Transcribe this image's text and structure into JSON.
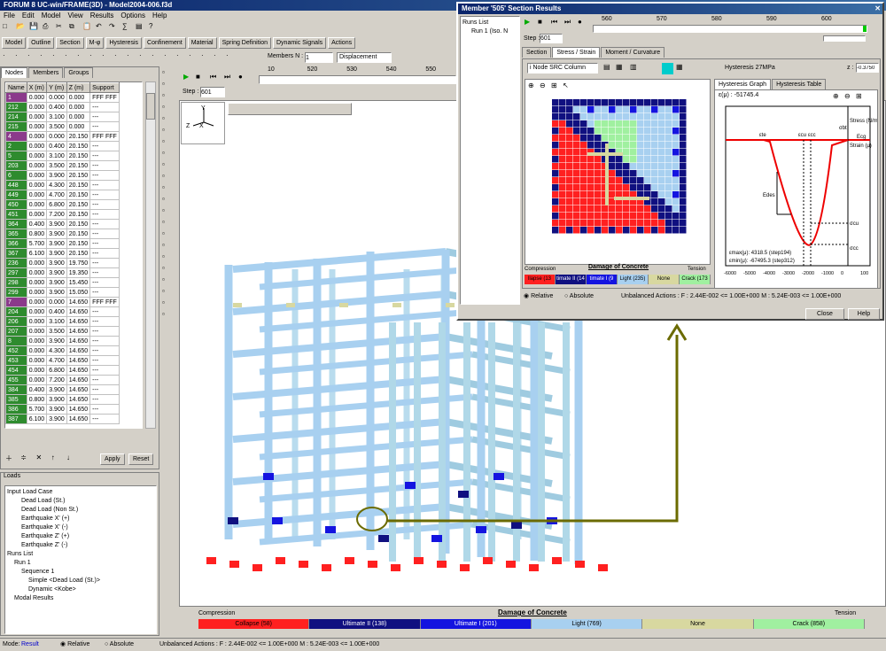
{
  "app": {
    "title": "FORUM 8 UC-win/FRAME(3D) - Model2004-006.f3d"
  },
  "menu": [
    "File",
    "Edit",
    "Model",
    "View",
    "Results",
    "Options",
    "Help"
  ],
  "toolbar2": [
    "Model",
    "Outline",
    "Section",
    "M-φ",
    "Hysteresis",
    "Confinement",
    "Material",
    "Spring Definition",
    "Dynamic Signals",
    "Actions"
  ],
  "viewer": {
    "members_label": "Members N :",
    "members_value": "1",
    "display_select": "Displacement",
    "ticks": [
      "10",
      "520",
      "530",
      "540",
      "550"
    ],
    "step_label": "Step :",
    "step_value": "601"
  },
  "left_tabs": [
    "Nodes",
    "Members",
    "Groups"
  ],
  "nodes_table": {
    "headers": [
      "Name",
      "X (m)",
      "Y (m)",
      "Z (m)",
      "Support"
    ],
    "rows": [
      [
        "1",
        "0.000",
        "0.000",
        "0.000",
        "FFF FFF"
      ],
      [
        "212",
        "0.000",
        "0.400",
        "0.000",
        "---"
      ],
      [
        "214",
        "0.000",
        "3.100",
        "0.000",
        "---"
      ],
      [
        "215",
        "0.000",
        "3.500",
        "0.000",
        "---"
      ],
      [
        "4",
        "0.000",
        "0.000",
        "20.150",
        "FFF FFF"
      ],
      [
        "2",
        "0.000",
        "0.400",
        "20.150",
        "---"
      ],
      [
        "5",
        "0.000",
        "3.100",
        "20.150",
        "---"
      ],
      [
        "203",
        "0.000",
        "3.500",
        "20.150",
        "---"
      ],
      [
        "6",
        "0.000",
        "3.900",
        "20.150",
        "---"
      ],
      [
        "448",
        "0.000",
        "4.300",
        "20.150",
        "---"
      ],
      [
        "449",
        "0.000",
        "4.700",
        "20.150",
        "---"
      ],
      [
        "450",
        "0.000",
        "6.800",
        "20.150",
        "---"
      ],
      [
        "451",
        "0.000",
        "7.200",
        "20.150",
        "---"
      ],
      [
        "364",
        "0.400",
        "3.900",
        "20.150",
        "---"
      ],
      [
        "365",
        "0.800",
        "3.900",
        "20.150",
        "---"
      ],
      [
        "366",
        "5.700",
        "3.900",
        "20.150",
        "---"
      ],
      [
        "367",
        "6.100",
        "3.900",
        "20.150",
        "---"
      ],
      [
        "236",
        "0.000",
        "3.900",
        "19.750",
        "---"
      ],
      [
        "297",
        "0.000",
        "3.900",
        "19.350",
        "---"
      ],
      [
        "298",
        "0.000",
        "3.900",
        "15.450",
        "---"
      ],
      [
        "299",
        "0.000",
        "3.900",
        "15.050",
        "---"
      ],
      [
        "7",
        "0.000",
        "0.000",
        "14.650",
        "FFF FFF"
      ],
      [
        "204",
        "0.000",
        "0.400",
        "14.650",
        "---"
      ],
      [
        "206",
        "0.000",
        "3.100",
        "14.650",
        "---"
      ],
      [
        "207",
        "0.000",
        "3.500",
        "14.650",
        "---"
      ],
      [
        "8",
        "0.000",
        "3.900",
        "14.650",
        "---"
      ],
      [
        "452",
        "0.000",
        "4.300",
        "14.650",
        "---"
      ],
      [
        "453",
        "0.000",
        "4.700",
        "14.650",
        "---"
      ],
      [
        "454",
        "0.000",
        "6.800",
        "14.650",
        "---"
      ],
      [
        "455",
        "0.000",
        "7.200",
        "14.650",
        "---"
      ],
      [
        "384",
        "0.400",
        "3.900",
        "14.650",
        "---"
      ],
      [
        "385",
        "0.800",
        "3.900",
        "14.650",
        "---"
      ],
      [
        "386",
        "5.700",
        "3.900",
        "14.650",
        "---"
      ],
      [
        "387",
        "6.100",
        "3.900",
        "14.650",
        "---"
      ]
    ]
  },
  "table_buttons": {
    "apply": "Apply",
    "reset": "Reset"
  },
  "loads": {
    "title": "Loads",
    "tree": [
      {
        "indent": 0,
        "text": "Input Load Case"
      },
      {
        "indent": 2,
        "text": "Dead Load (St.)"
      },
      {
        "indent": 2,
        "text": "Dead Load (Non St.)"
      },
      {
        "indent": 2,
        "text": "Earthquake X' (+)"
      },
      {
        "indent": 2,
        "text": "Earthquake X' (-)"
      },
      {
        "indent": 2,
        "text": "Earthquake Z' (+)"
      },
      {
        "indent": 2,
        "text": "Earthquake Z' (-)"
      },
      {
        "indent": 0,
        "text": "Runs List"
      },
      {
        "indent": 1,
        "text": "Run 1"
      },
      {
        "indent": 2,
        "text": "Sequence 1"
      },
      {
        "indent": 3,
        "text": "Simple <Dead Load (St.)>"
      },
      {
        "indent": 3,
        "text": "Dynamic <Kobe>"
      },
      {
        "indent": 1,
        "text": "Modal Results"
      }
    ]
  },
  "legend_main": {
    "title": "Damage of Concrete",
    "left": "Compression",
    "right": "Tension",
    "items": [
      {
        "label": "Collapse (58)",
        "color": "#ff2020"
      },
      {
        "label": "Ultimate II (138)",
        "color": "#101080"
      },
      {
        "label": "Ultimate I (201)",
        "color": "#1414e0"
      },
      {
        "label": "Light (769)",
        "color": "#a8d0f0"
      },
      {
        "label": "None",
        "color": "#d8d8a0"
      },
      {
        "label": "Crack (858)",
        "color": "#a0f0a0"
      }
    ]
  },
  "status": {
    "mode_label": "Mode:",
    "mode_value": "Result",
    "relative": "Relative",
    "absolute": "Absolute",
    "unbalanced": "Unbalanced Actions : F : 2.44E-002 <= 1.00E+000 M : 5.24E-003 <= 1.00E+000"
  },
  "dialog": {
    "title": "Member '505' Section Results",
    "runs_title": "Runs List",
    "run_item": "Run 1 (Iso. N",
    "step_label": "Step :",
    "step_value": "601",
    "ticks": [
      "560",
      "570",
      "580",
      "590",
      "600"
    ],
    "tabs": [
      "Section",
      "Stress / Strain",
      "Moment / Curvature"
    ],
    "section_select": "i Node SRC Column",
    "hysteresis_label": "Hysteresis 27MPa",
    "z_label": "z :",
    "z_value": "-0.3750",
    "graph_tabs": [
      "Hysteresis Graph",
      "Hysteresis Table"
    ],
    "epsilon_readout": "ε(μ) : -51745.4",
    "legend_title": "Damage of Concrete",
    "legend_left": "Compression",
    "legend_right": "Tension",
    "legend": [
      {
        "label": "llapse (13",
        "color": "#ff2020"
      },
      {
        "label": "timate II (14",
        "color": "#101080"
      },
      {
        "label": "timate I (9",
        "color": "#1414e0"
      },
      {
        "label": "Light (235)",
        "color": "#a8d0f0"
      },
      {
        "label": "None",
        "color": "#d8d8a0"
      },
      {
        "label": "Crack (173",
        "color": "#a0f0a0"
      }
    ],
    "graph_labels": {
      "stress": "Stress (N/m",
      "strain": "Strain (μ)",
      "eps_te": "εte",
      "eps_cu": "εcu",
      "eps_cc": "εcc",
      "e_des": "Edes",
      "e_cg": "Ecg",
      "sigma_bt": "σbt",
      "sigma_cu": "σcu",
      "sigma_cc": "σcc",
      "emax": "εmax(μ): 4318.5 (step194)",
      "emin": "εmin(μ): -67495.3 (step312)",
      "xticks": [
        "-6000",
        "-5000",
        "-4000",
        "-3000",
        "-2000",
        "-1000",
        "0",
        "100"
      ]
    },
    "relative": "Relative",
    "absolute": "Absolute",
    "unbalanced": "Unbalanced Actions : F : 2.44E-002 <= 1.00E+000 M : 5.24E-003 <= 1.00E+000",
    "close": "Close",
    "help": "Help"
  },
  "colors": {
    "collapse": "#ff2020",
    "ult2": "#101080",
    "ult1": "#1414e0",
    "light": "#a8d0f0",
    "none": "#d8d8a0",
    "crack": "#a0f0a0",
    "accent": "#6b6b00"
  }
}
